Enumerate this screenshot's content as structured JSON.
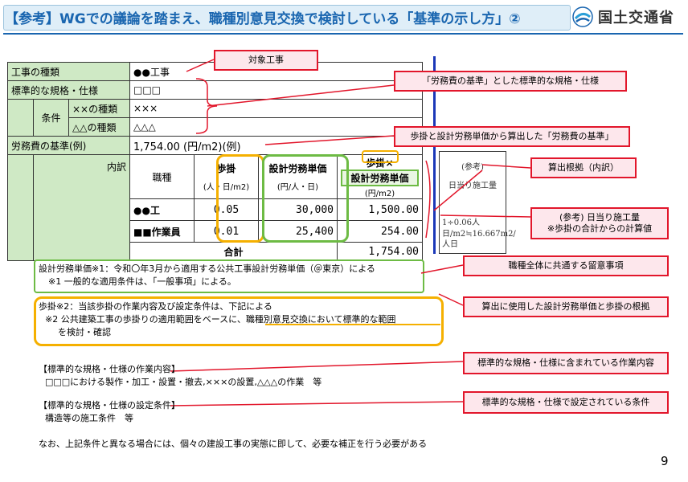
{
  "header": {
    "title": "【参考】WGでの議論を踏まえ、職種別意見交換で検討している「基準の示し方」②",
    "logo_text": "国土交通省"
  },
  "table": {
    "row1": {
      "label": "工事の種類",
      "value": "●●工事"
    },
    "row2": {
      "label": "標準的な規格・仕様",
      "value": "□□□"
    },
    "condition_label": "条件",
    "cond1": {
      "label": "××の種類",
      "value": "×××"
    },
    "cond2": {
      "label": "△△の種類",
      "value": "△△△"
    },
    "row5": {
      "label": "労務費の基準(例)",
      "value": "1,754.00 (円/m2)(例)"
    },
    "breakdown_label": "内訳",
    "headers": {
      "occupation": "職種",
      "rate": "歩掛",
      "rate_unit": "(人・日/m2)",
      "wage": "設計労務単価",
      "wage_unit": "(円/人・日)",
      "product_top": "歩掛×",
      "product_bottom": "設計労務単価",
      "product_unit": "(円/m2)",
      "ref_title": "(参考)",
      "ref_sub": "日当り施工量"
    },
    "rows": [
      {
        "occupation": "●●工",
        "rate": "0.05",
        "wage": "30,000",
        "product": "1,500.00"
      },
      {
        "occupation": "■■作業員",
        "rate": "0.01",
        "wage": "25,400",
        "product": "254.00"
      }
    ],
    "total_label": "合計",
    "total_value": "1,754.00",
    "ref_value": "1÷0.06人日/m2≒16.667m2/人日"
  },
  "callouts": {
    "c1": "対象工事",
    "c2": "「労務費の基準」とした標準的な規格・仕様",
    "c3": "歩掛と設計労務単価から算出した「労務費の基準」",
    "c4": "算出根拠（内訳）",
    "c5_line1": "(参考) 日当り施工量",
    "c5_line2": "※歩掛の合計からの計算値",
    "c6": "職種全体に共通する留意事項",
    "c7": "算出に使用した設計労務単価と歩掛の根拠",
    "c8": "標準的な規格・仕様に含まれている作業内容",
    "c9": "標準的な規格・仕様で設定されている条件"
  },
  "notes": {
    "wage_line1": "設計労務単価※1：令和〇年3月から適用する公共工事設計労務単価（＠東京）による",
    "wage_line2": "※1 一般的な適用条件は、「一般事項」による。",
    "rate_line1": "歩掛※2：当該歩掛の作業内容及び設定条件は、下記による",
    "rate_line2": "※2 公共建築工事の歩掛りの適用範囲をベースに、職種別意見交換において標準的な範囲",
    "rate_line3": "を検討・確認",
    "work_title": "【標準的な規格・仕様の作業内容】",
    "work_body": "□□□における製作・加工・設置・撤去,×××の設置,△△△の作業　等",
    "cond_title": "【標準的な規格・仕様の設定条件】",
    "cond_body": "構造等の施工条件　等",
    "footer": "なお、上記条件と異なる場合には、個々の建設工事の実態に即して、必要な補正を行う必要がある"
  },
  "page_number": "9",
  "colors": {
    "title": "#1a66b0",
    "table_green": "#cfe9c5",
    "callout_border": "#e2162b",
    "callout_fill": "#fde7ec",
    "highlight_yellow": "#f5b000",
    "highlight_green": "#6dbb44",
    "separator_blue": "#1b38b8"
  }
}
